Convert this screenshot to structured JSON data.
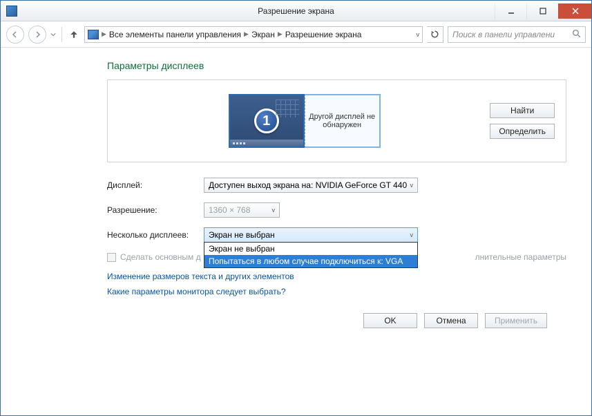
{
  "window": {
    "title": "Разрешение экрана"
  },
  "breadcrumb": {
    "root": "Все элементы панели управления",
    "mid": "Экран",
    "leaf": "Разрешение экрана"
  },
  "search": {
    "placeholder": "Поиск в панели управлени"
  },
  "section_title": "Параметры дисплеев",
  "displays": {
    "primary_number": "1",
    "secondary_text": "Другой дисплей не обнаружен"
  },
  "side_buttons": {
    "find": "Найти",
    "identify": "Определить"
  },
  "fields": {
    "display_label": "Дисплей:",
    "display_value": "Доступен выход экрана на: NVIDIA GeForce GT 440",
    "resolution_label": "Разрешение:",
    "resolution_value": "1360 × 768",
    "multi_label": "Несколько дисплеев:",
    "multi_value": "Экран не выбран",
    "multi_options": [
      "Экран не выбран",
      "Попытаться в любом случае подключиться к: VGA"
    ]
  },
  "checkbox": {
    "label": "Сделать основным д",
    "advanced_link": "лнительные параметры"
  },
  "links": {
    "resize": "Изменение размеров текста и других элементов",
    "which": "Какие параметры монитора следует выбрать?"
  },
  "footer": {
    "ok": "OK",
    "cancel": "Отмена",
    "apply": "Применить"
  }
}
